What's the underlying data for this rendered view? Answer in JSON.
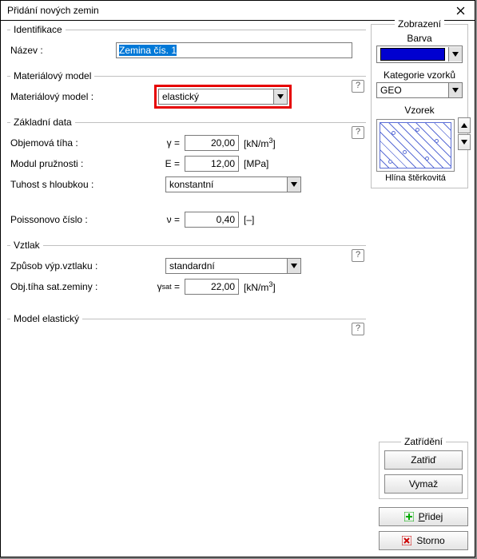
{
  "window": {
    "title": "Přidání nových zemin"
  },
  "identifikace": {
    "legend": "Identifikace",
    "name_label": "Název :",
    "name_value": "Zemina čís. 1"
  },
  "mat_model": {
    "legend": "Materiálový model",
    "label": "Materiálový model :",
    "value": "elastický"
  },
  "zakladni": {
    "legend": "Základní data",
    "unit_weight_label": "Objemová tíha :",
    "unit_weight_sym": "γ =",
    "unit_weight_val": "20,00",
    "unit_weight_unit": "[kN/m³]",
    "e_label": "Modul pružnosti :",
    "e_sym": "E =",
    "e_val": "12,00",
    "e_unit": "[MPa]",
    "depth_label": "Tuhost s hloubkou :",
    "depth_val": "konstantní",
    "poisson_label": "Poissonovo číslo :",
    "poisson_sym": "ν =",
    "poisson_val": "0,40",
    "poisson_unit": "[–]"
  },
  "vztlak": {
    "legend": "Vztlak",
    "method_label": "Způsob výp.vztlaku :",
    "method_val": "standardní",
    "sat_label": "Obj.tíha sat.zeminy :",
    "sat_sym": "γsat =",
    "sat_val": "22,00",
    "sat_unit": "[kN/m³]"
  },
  "elasticky": {
    "legend": "Model elastický"
  },
  "zobrazeni": {
    "legend": "Zobrazení",
    "barva": "Barva",
    "kategorie_label": "Kategorie vzorků",
    "kategorie_val": "GEO",
    "vzorek_label": "Vzorek",
    "pattern_caption": "Hlína štěrkovitá"
  },
  "zatrideni": {
    "legend": "Zatřídění",
    "zatrid": "Zatřiď",
    "vymaz": "Vymaž"
  },
  "buttons": {
    "pridej": "Přidej",
    "storno": "Storno"
  }
}
